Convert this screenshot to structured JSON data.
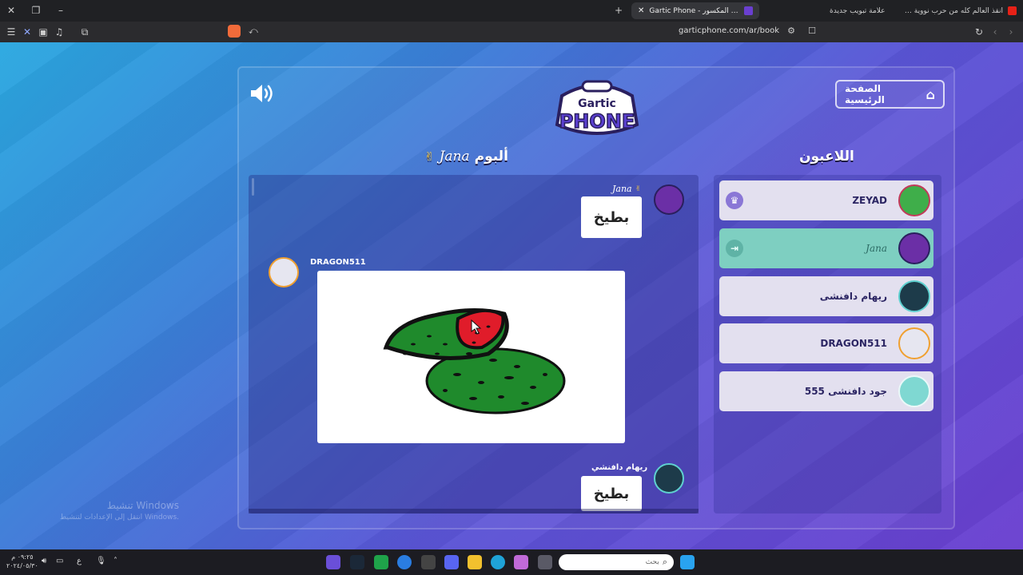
{
  "browser": {
    "tabs": [
      {
        "title": "أنقذ العالم كله من حرب نووية 🌍 #bet…",
        "active": false
      },
      {
        "title": "علامة تبويب جديدة",
        "active": false
      },
      {
        "title": "Gartic Phone - لعبة الهاتف المكسور",
        "active": true
      }
    ],
    "new_tab": "+",
    "url": "garticphone.com/ar/book"
  },
  "page": {
    "home_button": "الصفحة الرئيسية",
    "logo_line1": "Gartic",
    "logo_line2": "PHONE",
    "players_title": "اللاعبون",
    "album_title": "ألبوم",
    "album_owner": "Jana",
    "players": [
      {
        "name": "ZEYAD",
        "style": "normal",
        "avatar_color": "#3fae4a"
      },
      {
        "name": "Jana",
        "style": "script",
        "avatar_color": "#6b2fa6"
      },
      {
        "name": "ريهام دافنشى",
        "style": "normal",
        "avatar_color": "#1d3b4a"
      },
      {
        "name": "DRAGON511",
        "style": "normal",
        "avatar_color": "#e6e6f0"
      },
      {
        "name": "جود دافنشى 555",
        "style": "normal",
        "avatar_color": "#7fd8d2"
      }
    ],
    "album": {
      "entries": [
        {
          "author": "Jana",
          "type": "text",
          "text": "بطيخ"
        },
        {
          "author": "DRAGON511",
          "type": "drawing"
        },
        {
          "author": "ريهام دافنشي",
          "type": "text",
          "text": "بطيخ"
        }
      ]
    }
  },
  "watermark": {
    "line1": "تنشيط Windows",
    "line2": "انتقل إلى الإعدادات لتنشيط Windows."
  },
  "taskbar": {
    "search_placeholder": "بحث",
    "time": "٠٩:٢٥ م",
    "date": "٢٠٢٤/٠٥/٣٠",
    "lang": "ع"
  },
  "colors": {
    "accent_teal": "#7ecfc1",
    "player_row": "#e3e0ef",
    "brand_purple": "#6a3fd0"
  }
}
